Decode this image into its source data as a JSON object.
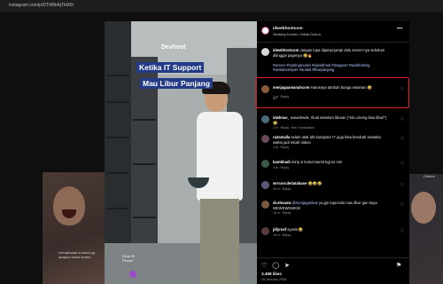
{
  "browser": {
    "url": "instagram.com/p/DTrMlnAjTkM0/"
  },
  "background": {
    "left_caption": "menghadap cruaran yg apapun sama temen",
    "right_label": "Dimbot"
  },
  "media": {
    "logo": "Devhost",
    "caption_line1": "Ketika IT Support",
    "caption_line2": "Mau Libur Panjang",
    "pip_text": "Sinar Bi\nPencul"
  },
  "header": {
    "username": "idwebhostcom",
    "subtitle": "Sindang Komisi • Mbak Dukun",
    "more_icon": "more-dots-icon"
  },
  "comments": [
    {
      "user": "idwebhostcom",
      "text": "Jangan lupa dijampi-jampi dulu server-nya sebelum ditinggal pagenya 😂🔥",
      "hashtags": "#server #hostingmurah #idwebhost #itsupport #webhosting #webdeveloper #anakit #liburpanjang",
      "time": "6h",
      "color": "#d8d8d8"
    },
    {
      "user": "menjagaamanahcom",
      "text": "Harusnya tambah bunga setaman 😅",
      "time": "1 m",
      "reply": "Reply",
      "color": "#8a5a3a"
    },
    {
      "user": "idwlmas_",
      "text": "awwahwok, ritual sebelum liburan (\"elo uroong bisa libur!\") 😂",
      "time": "2 m",
      "reply": "Reply",
      "extra": "See Translation",
      "color": "#4a6a7a"
    },
    {
      "user": "ra2amalla",
      "text": "selain otak aht komputer IT juga bisa berubah sewaktu waktu jadi mbah dukun",
      "time": "1 m",
      "reply": "Reply",
      "color": "#6a4a5a"
    },
    {
      "user": "bambhadi",
      "text": "mirip si komet kamit bgt ini min",
      "time": "3 m",
      "reply": "Reply",
      "color": "#3a5a4a"
    },
    {
      "user": "wrrcorcdedatabase",
      "text": "😂😂😂",
      "time": "10 m",
      "reply": "Reply",
      "color": "#5a5a7a"
    },
    {
      "user": "dr.ehsanw",
      "mention": "@menjaganitas",
      "text": "ya jgn lupa kalo mau libur gan kaya WKWKWKWKW",
      "time": "15 m",
      "reply": "Reply",
      "color": "#7a5a3a"
    },
    {
      "user": "jdlyrnsf",
      "text": "syarat 😂",
      "time": "19 m",
      "reply": "Reply",
      "color": "#5a3a3a"
    }
  ],
  "footer": {
    "likes": "3.488 likes",
    "date": "26 January 2025",
    "action_icons": "♡ ◯ ➤",
    "bookmark_icon": "bookmark-icon"
  },
  "colors": {
    "highlight": "#e11b22",
    "caption_bg": "#233a86"
  }
}
